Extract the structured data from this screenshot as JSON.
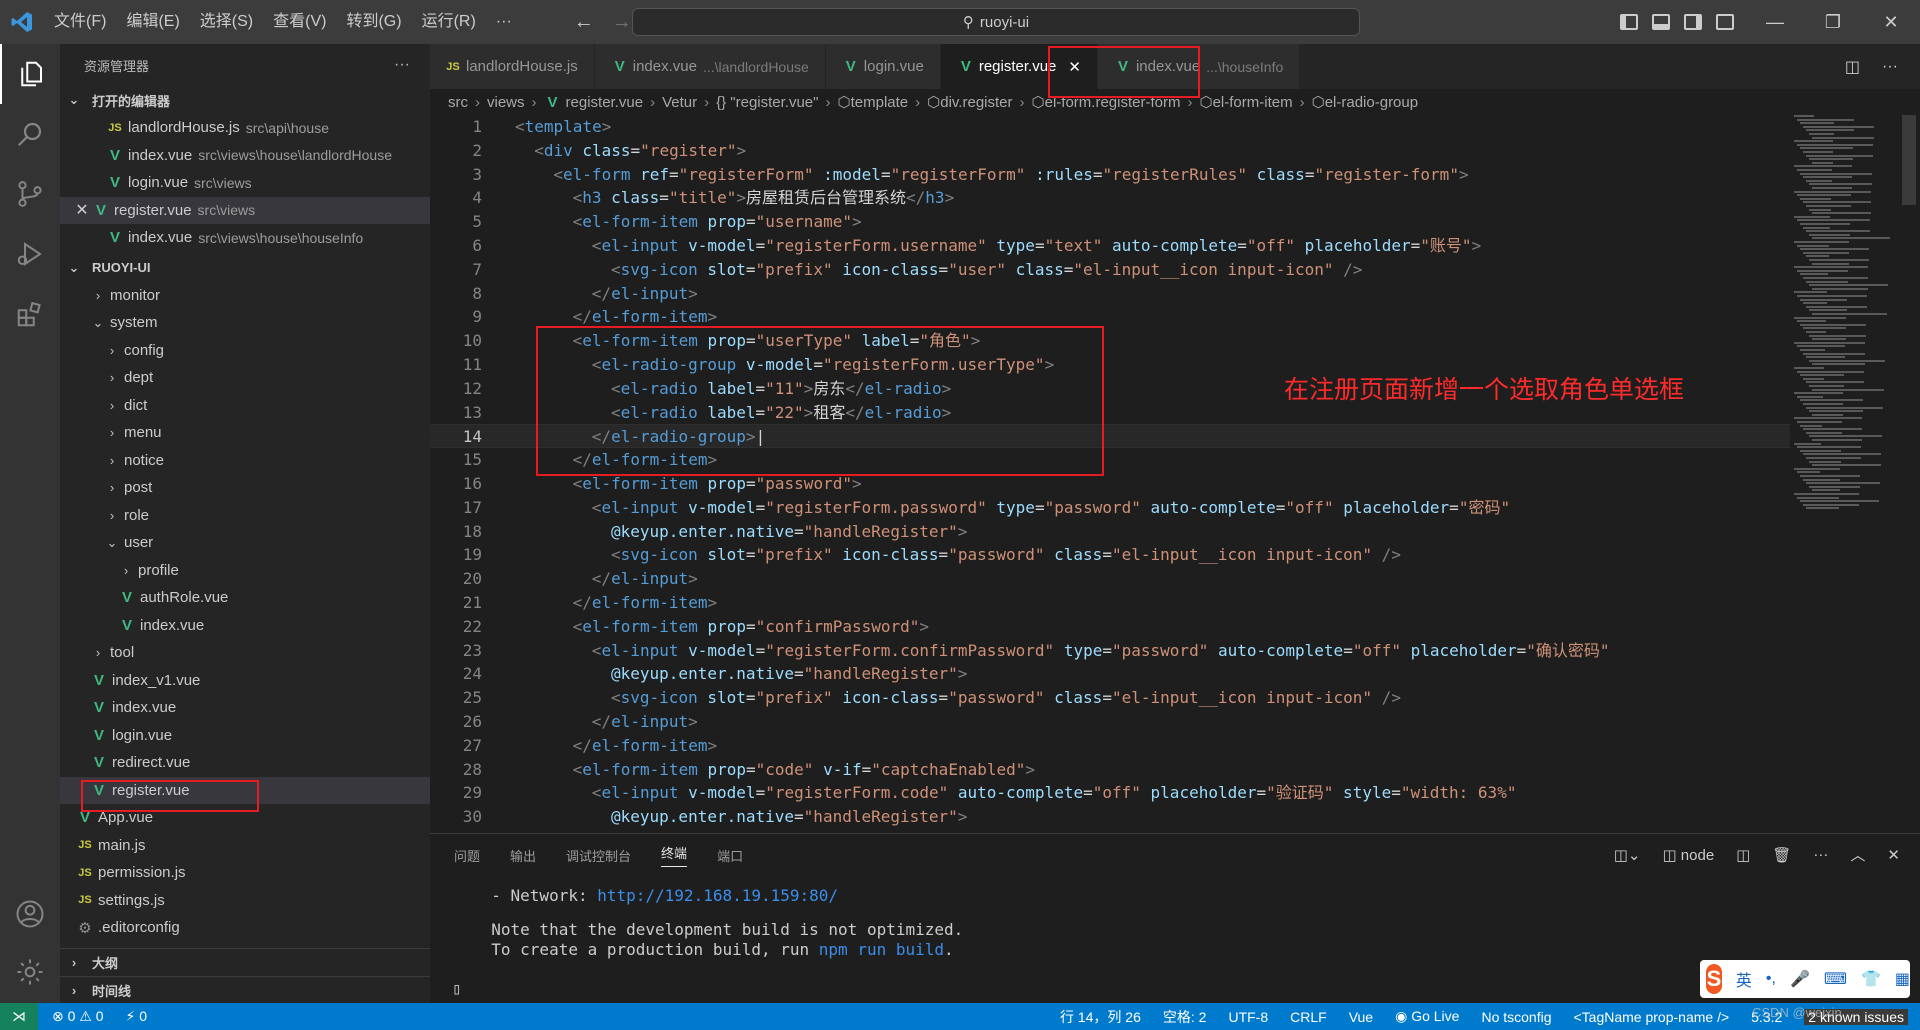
{
  "titlebar": {
    "menu": [
      "文件(F)",
      "编辑(E)",
      "选择(S)",
      "查看(V)",
      "转到(G)",
      "运行(R)",
      "···"
    ],
    "search": "ruoyi-ui"
  },
  "sidebar": {
    "title": "资源管理器",
    "open_editors_title": "打开的编辑器",
    "open_editors": [
      {
        "icon": "JS",
        "name": "landlordHouse.js",
        "path": "src\\api\\house"
      },
      {
        "icon": "V",
        "name": "index.vue",
        "path": "src\\views\\house\\landlordHouse"
      },
      {
        "icon": "V",
        "name": "login.vue",
        "path": "src\\views"
      },
      {
        "icon": "V",
        "name": "register.vue",
        "path": "src\\views"
      },
      {
        "icon": "V",
        "name": "index.vue",
        "path": "src\\views\\house\\houseInfo"
      }
    ],
    "project_title": "RUOYI-UI",
    "tree": [
      {
        "kind": "folder",
        "name": "monitor",
        "open": false,
        "level": 1
      },
      {
        "kind": "folder",
        "name": "system",
        "open": true,
        "level": 1
      },
      {
        "kind": "folder",
        "name": "config",
        "open": false,
        "level": 2
      },
      {
        "kind": "folder",
        "name": "dept",
        "open": false,
        "level": 2
      },
      {
        "kind": "folder",
        "name": "dict",
        "open": false,
        "level": 2
      },
      {
        "kind": "folder",
        "name": "menu",
        "open": false,
        "level": 2
      },
      {
        "kind": "folder",
        "name": "notice",
        "open": false,
        "level": 2
      },
      {
        "kind": "folder",
        "name": "post",
        "open": false,
        "level": 2
      },
      {
        "kind": "folder",
        "name": "role",
        "open": false,
        "level": 2
      },
      {
        "kind": "folder",
        "name": "user",
        "open": true,
        "level": 2
      },
      {
        "kind": "folder",
        "name": "profile",
        "open": false,
        "level": 3
      },
      {
        "kind": "vue",
        "name": "authRole.vue",
        "level": 3
      },
      {
        "kind": "vue",
        "name": "index.vue",
        "level": 3
      },
      {
        "kind": "folder",
        "name": "tool",
        "open": false,
        "level": 1
      },
      {
        "kind": "vue",
        "name": "index_v1.vue",
        "level": 1
      },
      {
        "kind": "vue",
        "name": "index.vue",
        "level": 1
      },
      {
        "kind": "vue",
        "name": "login.vue",
        "level": 1
      },
      {
        "kind": "vue",
        "name": "redirect.vue",
        "level": 1
      },
      {
        "kind": "vue",
        "name": "register.vue",
        "level": 1,
        "selected": true
      },
      {
        "kind": "vue",
        "name": "App.vue",
        "level": 0
      },
      {
        "kind": "js",
        "name": "main.js",
        "level": 0
      },
      {
        "kind": "js",
        "name": "permission.js",
        "level": 0
      },
      {
        "kind": "js",
        "name": "settings.js",
        "level": 0
      },
      {
        "kind": "gear",
        "name": ".editorconfig",
        "level": 0
      }
    ],
    "outline_title": "大纲",
    "timeline_title": "时间线"
  },
  "tabs": [
    {
      "icon": "JS",
      "name": "landlordHouse.js",
      "sub": ""
    },
    {
      "icon": "V",
      "name": "index.vue",
      "sub": "...\\landlordHouse"
    },
    {
      "icon": "V",
      "name": "login.vue",
      "sub": ""
    },
    {
      "icon": "V",
      "name": "register.vue",
      "sub": "",
      "active": true
    },
    {
      "icon": "V",
      "name": "index.vue",
      "sub": "...\\houseInfo"
    }
  ],
  "breadcrumb": [
    "src",
    "views",
    "register.vue",
    "Vetur",
    "{} \"register.vue\"",
    "template",
    "div.register",
    "el-form.register-form",
    "el-form-item",
    "el-radio-group"
  ],
  "annotation": "在注册页面新增一个选取角色单选框",
  "panel": {
    "tabs": [
      "问题",
      "输出",
      "调试控制台",
      "终端",
      "端口"
    ],
    "active_tab": "终端",
    "shell": "node",
    "network_label": "  - Network: ",
    "network_url": "http://192.168.19.159:80/",
    "note1": "  Note that the development build is not optimized.",
    "note2_prefix": "  To create a production build, run ",
    "note2_cmd": "npm run build",
    "note2_suffix": "."
  },
  "statusbar": {
    "errors": "⊗ 0 ⚠ 0",
    "ports": "0",
    "position": "行 14，列 26",
    "spaces": "空格: 2",
    "encoding": "UTF-8",
    "eol": "CRLF",
    "language": "Vue",
    "golive": "Go Live",
    "tsconfig": "No tsconfig",
    "tag": "<TagName prop-name />",
    "version": "5.3.2",
    "issues": "2 known issues"
  },
  "ime": {
    "lang": "英"
  },
  "watermark": "CSDN @weixin"
}
